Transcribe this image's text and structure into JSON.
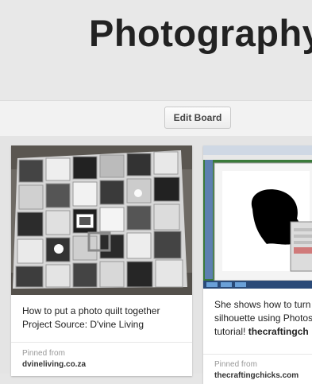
{
  "board": {
    "title": "Photography",
    "edit_button": "Edit Board"
  },
  "pins": [
    {
      "description": "How to put a photo quilt together Project Source: D'vine Living",
      "pinned_from_label": "Pinned from",
      "source": "dvineliving.co.za"
    },
    {
      "description_line1": "She shows how to turn",
      "description_line2": "silhouette using Photos",
      "description_line3": "tutorial!",
      "description_attribution": "thecraftingch",
      "pinned_from_label": "Pinned from",
      "source": "thecraftingchicks.com"
    }
  ]
}
